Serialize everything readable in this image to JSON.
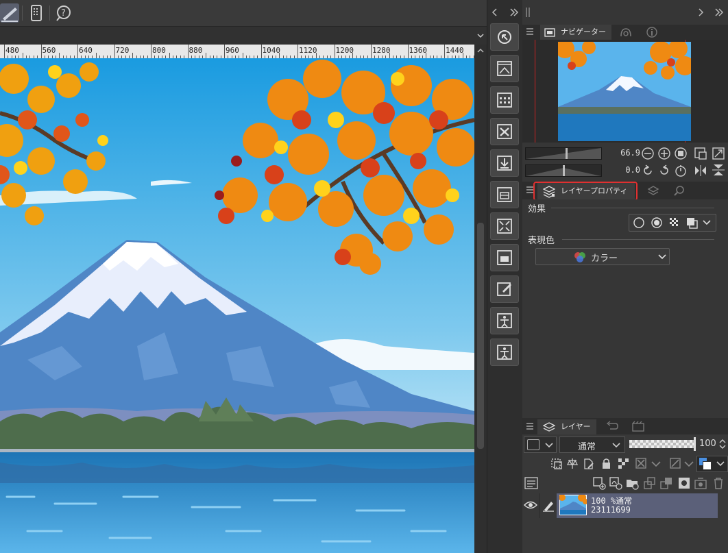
{
  "toolbar": {
    "icons": [
      "pen-tool-icon",
      "device-icon",
      "help-icon"
    ]
  },
  "ruler": {
    "labels": [
      "480",
      "560",
      "640",
      "720",
      "800",
      "880",
      "960",
      "1040",
      "1120",
      "1200",
      "1280",
      "1360",
      "1440"
    ]
  },
  "iconcol": {
    "icons": [
      "navigator-icon",
      "material-icon",
      "grid-icon",
      "close-file-icon",
      "import-icon",
      "layout-icon",
      "shrink-icon",
      "image-icon",
      "edit-icon",
      "figure-icon",
      "figure2-icon"
    ]
  },
  "navigator": {
    "tab_label": "ナビゲーター",
    "zoom_value": "66.9",
    "rotate_value": "0.0"
  },
  "layer_property": {
    "tab_label": "レイヤープロパティ",
    "effect_label": "効果",
    "expression_label": "表現色",
    "expression_value": "カラー",
    "highlight_color": "#e03030"
  },
  "layers": {
    "tab_label": "レイヤー",
    "blend_mode": "通常",
    "opacity": "100",
    "items": [
      {
        "line1": "100 %通常",
        "line2": "23111699"
      }
    ]
  },
  "colors": {
    "accent": "#4a90e2",
    "selected_layer": "#5b6079"
  }
}
